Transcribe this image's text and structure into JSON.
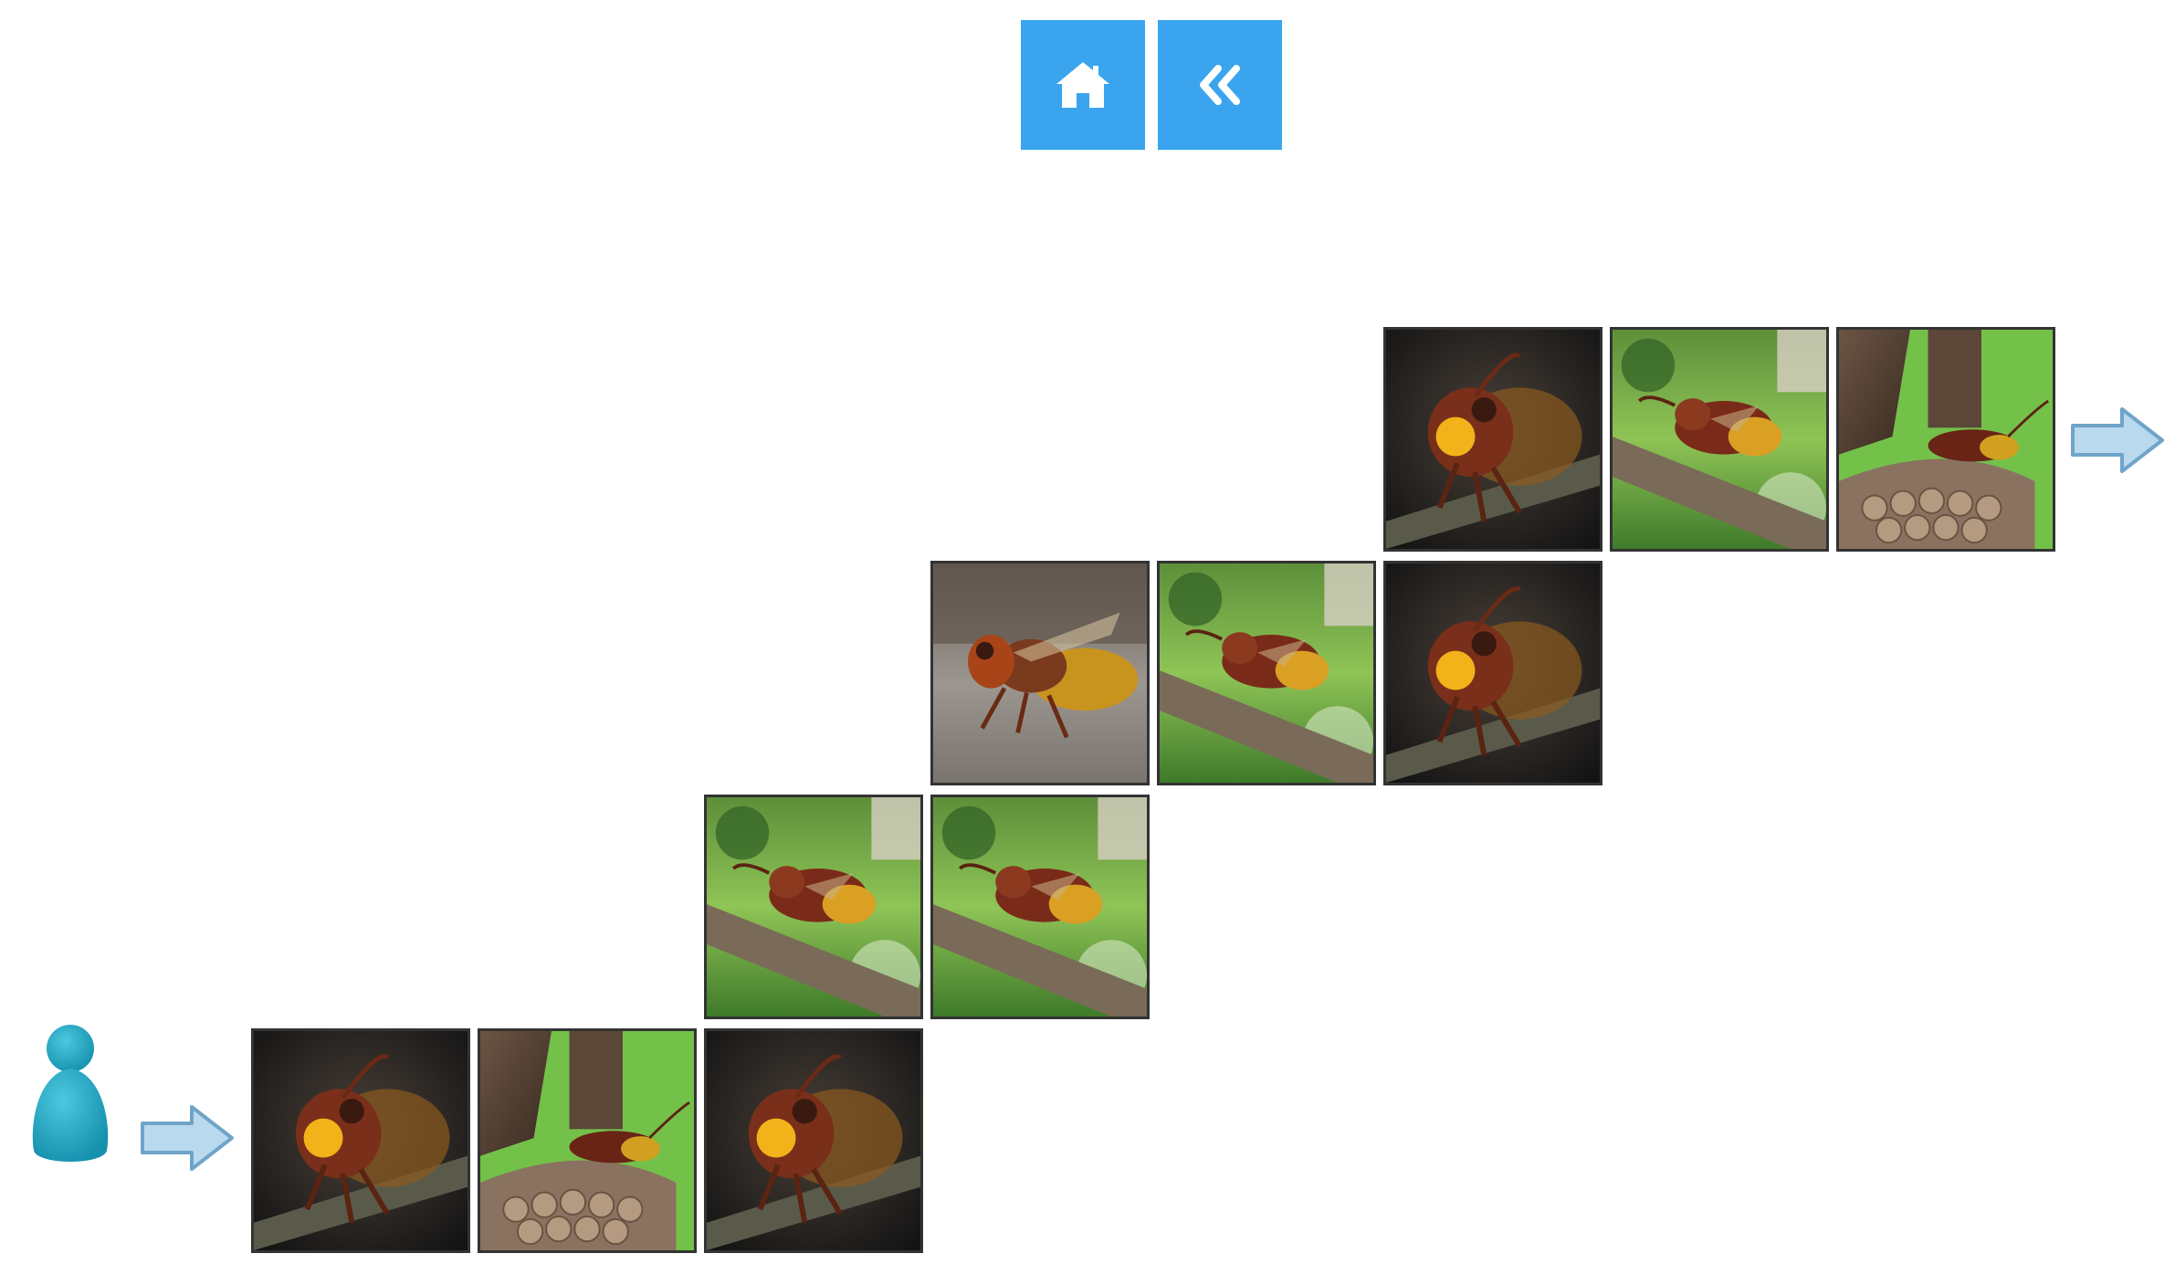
{
  "toolbar": {
    "accent_color": "#3aa4ee",
    "home_button": {
      "icon": "home-icon"
    },
    "back_button": {
      "icon": "double-chevron-left-icon"
    }
  },
  "board": {
    "player": {
      "icon": "player-pawn-icon",
      "color": "#1fa8c4"
    },
    "start_arrow": {
      "icon": "arrow-right-icon"
    },
    "exit_arrow": {
      "icon": "arrow-right-icon"
    },
    "tiles": [
      {
        "row": 1,
        "col": 1,
        "image": "hornet-closeup-dark"
      },
      {
        "row": 1,
        "col": 2,
        "image": "hornet-on-nest"
      },
      {
        "row": 1,
        "col": 3,
        "image": "hornet-closeup-dark"
      },
      {
        "row": 2,
        "col": 3,
        "image": "hornet-on-branch"
      },
      {
        "row": 2,
        "col": 4,
        "image": "hornet-on-branch"
      },
      {
        "row": 3,
        "col": 4,
        "image": "hornet-side-ground"
      },
      {
        "row": 3,
        "col": 5,
        "image": "hornet-on-branch"
      },
      {
        "row": 3,
        "col": 6,
        "image": "hornet-closeup-dark"
      },
      {
        "row": 4,
        "col": 6,
        "image": "hornet-closeup-dark"
      },
      {
        "row": 4,
        "col": 7,
        "image": "hornet-on-branch"
      },
      {
        "row": 4,
        "col": 8,
        "image": "hornet-on-nest"
      }
    ]
  }
}
